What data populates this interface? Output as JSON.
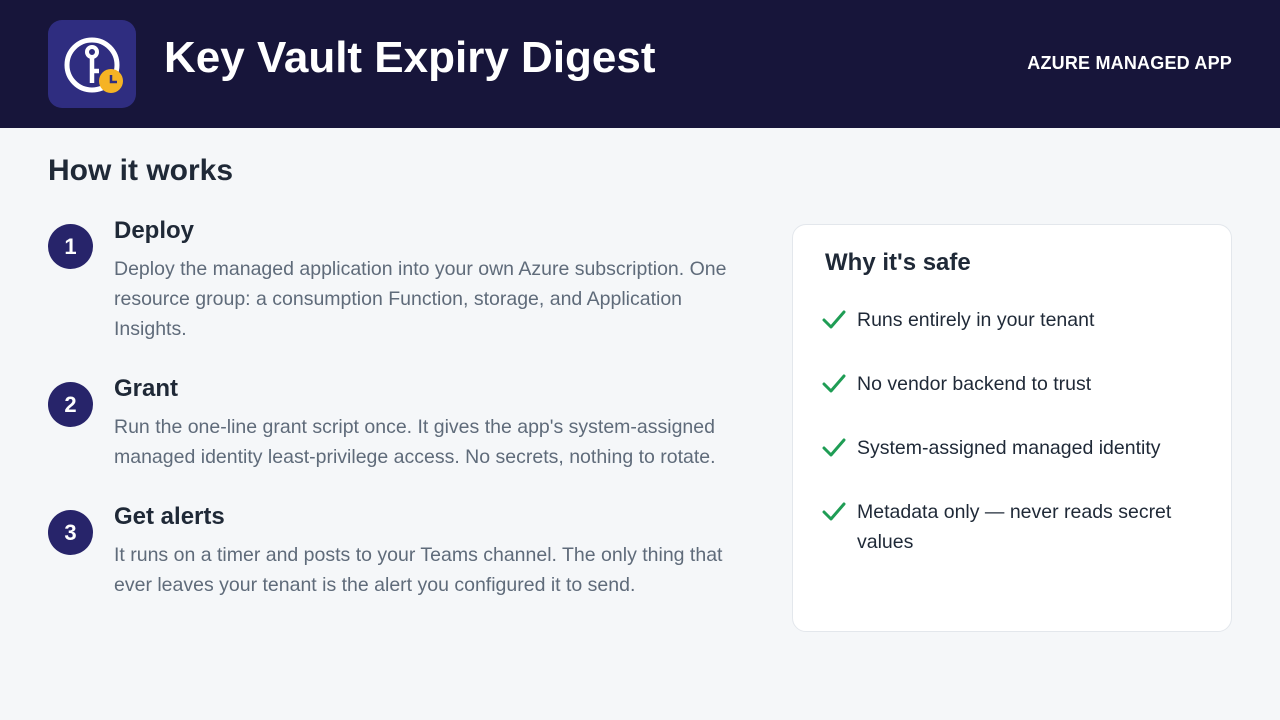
{
  "header": {
    "title": "Key Vault Expiry Digest",
    "badge": "AZURE MANAGED APP",
    "logo_icon": "key-clock-icon",
    "background_color": "#17153a",
    "logo_color": "#2f2d80",
    "clock_color": "#f5b324"
  },
  "main": {
    "section_title": "How it works",
    "steps": [
      {
        "number": "1",
        "title": "Deploy",
        "description": "Deploy the managed application into your own Azure subscription. One resource group: a consumption Function, storage, and Application Insights."
      },
      {
        "number": "2",
        "title": "Grant",
        "description": "Run the one-line grant script once. It gives the app's system-assigned managed identity least-privilege access. No secrets, nothing to rotate."
      },
      {
        "number": "3",
        "title": "Get alerts",
        "description": "It runs on a timer and posts to your Teams channel. The only thing that ever leaves your tenant is the alert you configured it to send."
      }
    ]
  },
  "safety_card": {
    "title": "Why it's safe",
    "check_icon": "checkmark-icon",
    "check_color": "#1f9d55",
    "items": [
      {
        "text": "Runs entirely in your tenant"
      },
      {
        "text": "No vendor backend to trust"
      },
      {
        "text": "System-assigned managed identity"
      },
      {
        "text": "Metadata only — never reads secret values"
      }
    ]
  }
}
